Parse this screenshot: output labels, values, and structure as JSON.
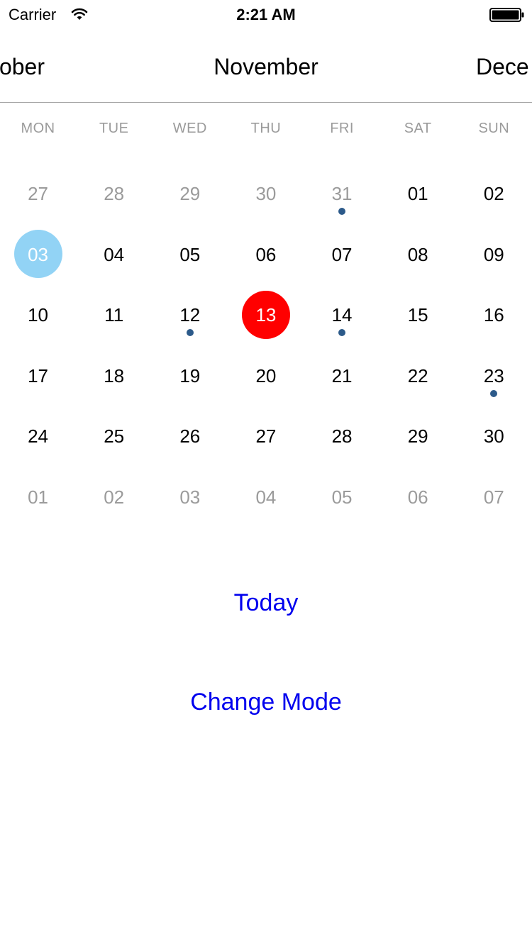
{
  "status_bar": {
    "carrier": "Carrier",
    "time": "2:21 AM",
    "icons": [
      "wifi-icon",
      "battery-icon"
    ]
  },
  "month_scroller": {
    "previous": "ober",
    "current": "November",
    "next": "Dece"
  },
  "weekdays": [
    "MON",
    "TUE",
    "WED",
    "THU",
    "FRI",
    "SAT",
    "SUN"
  ],
  "weeks": [
    [
      {
        "label": "27",
        "outside": true
      },
      {
        "label": "28",
        "outside": true
      },
      {
        "label": "29",
        "outside": true
      },
      {
        "label": "30",
        "outside": true
      },
      {
        "label": "31",
        "outside": true,
        "event": true
      },
      {
        "label": "01"
      },
      {
        "label": "02"
      }
    ],
    [
      {
        "label": "03",
        "selected": true
      },
      {
        "label": "04"
      },
      {
        "label": "05"
      },
      {
        "label": "06"
      },
      {
        "label": "07"
      },
      {
        "label": "08"
      },
      {
        "label": "09"
      }
    ],
    [
      {
        "label": "10"
      },
      {
        "label": "11"
      },
      {
        "label": "12",
        "event": true
      },
      {
        "label": "13",
        "today": true
      },
      {
        "label": "14",
        "event": true
      },
      {
        "label": "15"
      },
      {
        "label": "16"
      }
    ],
    [
      {
        "label": "17"
      },
      {
        "label": "18"
      },
      {
        "label": "19"
      },
      {
        "label": "20"
      },
      {
        "label": "21"
      },
      {
        "label": "22"
      },
      {
        "label": "23",
        "event": true
      }
    ],
    [
      {
        "label": "24"
      },
      {
        "label": "25"
      },
      {
        "label": "26"
      },
      {
        "label": "27"
      },
      {
        "label": "28"
      },
      {
        "label": "29"
      },
      {
        "label": "30"
      }
    ],
    [
      {
        "label": "01",
        "outside": true
      },
      {
        "label": "02",
        "outside": true
      },
      {
        "label": "03",
        "outside": true
      },
      {
        "label": "04",
        "outside": true
      },
      {
        "label": "05",
        "outside": true
      },
      {
        "label": "06",
        "outside": true
      },
      {
        "label": "07",
        "outside": true
      }
    ]
  ],
  "actions": {
    "today": "Today",
    "change_mode": "Change Mode"
  },
  "colors": {
    "selected_day": "#92d3f5",
    "today_day": "#ff0000",
    "event_dot": "#2c5a8a",
    "button_text": "#0000ee",
    "muted_text": "#9b9b9b"
  }
}
